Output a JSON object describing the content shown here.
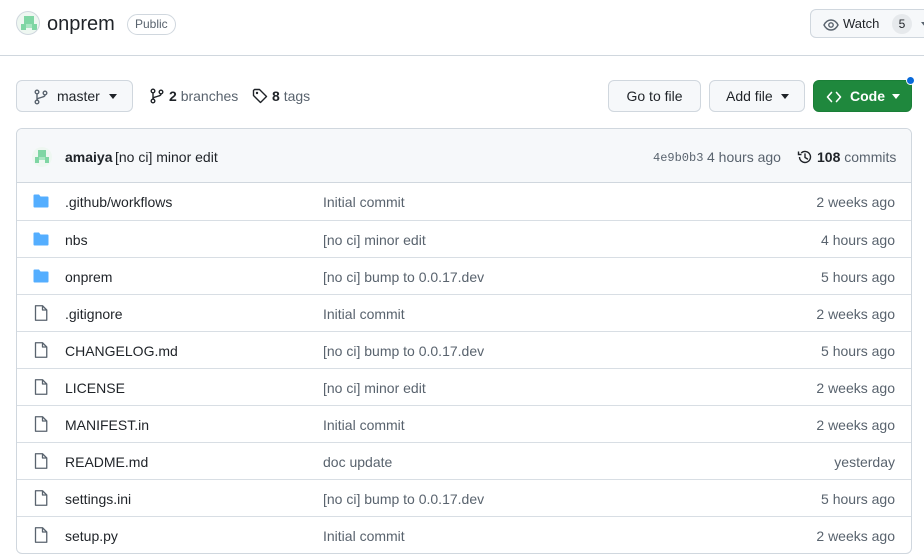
{
  "repo": {
    "name": "onprem",
    "visibility": "Public",
    "watch_label": "Watch",
    "watch_count": "5"
  },
  "toolbar": {
    "branch": "master",
    "branches_count": "2",
    "branches_label": "branches",
    "tags_count": "8",
    "tags_label": "tags",
    "goto_file": "Go to file",
    "add_file": "Add file",
    "code": "Code"
  },
  "latest_commit": {
    "author": "amaiya",
    "message": "[no ci] minor edit",
    "sha": "4e9b0b3",
    "time": "4 hours ago",
    "count": "108",
    "count_label": "commits"
  },
  "files": [
    {
      "type": "folder",
      "name": ".github/workflows",
      "message": "Initial commit",
      "age": "2 weeks ago"
    },
    {
      "type": "folder",
      "name": "nbs",
      "message": "[no ci] minor edit",
      "age": "4 hours ago"
    },
    {
      "type": "folder",
      "name": "onprem",
      "message": "[no ci] bump to 0.0.17.dev",
      "age": "5 hours ago"
    },
    {
      "type": "file",
      "name": ".gitignore",
      "message": "Initial commit",
      "age": "2 weeks ago"
    },
    {
      "type": "file",
      "name": "CHANGELOG.md",
      "message": "[no ci] bump to 0.0.17.dev",
      "age": "5 hours ago"
    },
    {
      "type": "file",
      "name": "LICENSE",
      "message": "[no ci] minor edit",
      "age": "2 weeks ago"
    },
    {
      "type": "file",
      "name": "MANIFEST.in",
      "message": "Initial commit",
      "age": "2 weeks ago"
    },
    {
      "type": "file",
      "name": "README.md",
      "message": "doc update",
      "age": "yesterday"
    },
    {
      "type": "file",
      "name": "settings.ini",
      "message": "[no ci] bump to 0.0.17.dev",
      "age": "5 hours ago"
    },
    {
      "type": "file",
      "name": "setup.py",
      "message": "Initial commit",
      "age": "2 weeks ago"
    }
  ],
  "colors": {
    "folder": "#54aeff",
    "file": "#59636e",
    "code_button": "#1f883d",
    "link": "#0969da"
  }
}
